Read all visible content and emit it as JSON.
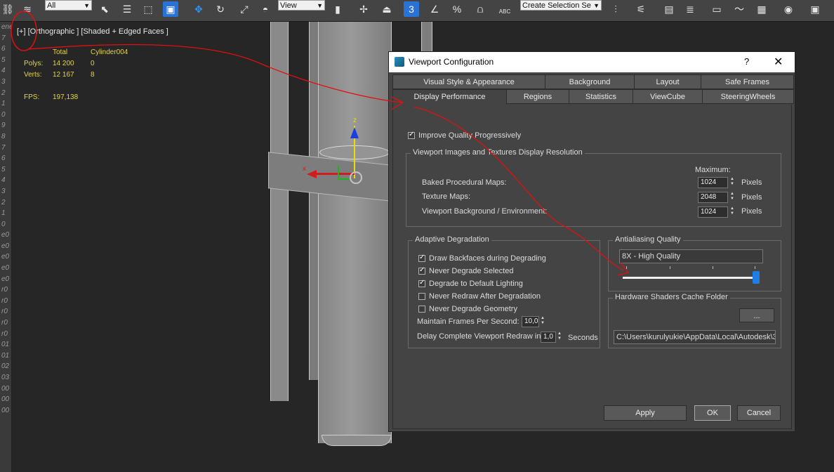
{
  "toolbar": {
    "filter_select": "All",
    "refcoord_select": "View",
    "selection_set_placeholder": "Create Selection Se",
    "snap_label": "3",
    "percent_label": "%",
    "abc_label": "ABC"
  },
  "left_strip": [
    "ene",
    "7",
    "6",
    "5",
    "4",
    "3",
    "2",
    "1",
    "0",
    "9",
    "8",
    "7",
    "6",
    "5",
    "4",
    "3",
    "2",
    "1",
    "0",
    "e0",
    "e0",
    "e0",
    "e0",
    "e0",
    "r0",
    "r0",
    "r0",
    "r0",
    "r0",
    "01",
    "01",
    "02",
    "03",
    "00",
    "00",
    "00"
  ],
  "viewport": {
    "label": "[+] [Orthographic ] [Shaded + Edged Faces ]",
    "stats": {
      "total_header": "Total",
      "object_name": "Cylinder004",
      "polys_label": "Polys:",
      "polys_total": "14 200",
      "polys_obj": "0",
      "verts_label": "Verts:",
      "verts_total": "12 167",
      "verts_obj": "8",
      "fps_label": "FPS:",
      "fps_value": "197,138"
    },
    "gizmo": {
      "z": "z",
      "x": "x"
    }
  },
  "dialog": {
    "title": "Viewport Configuration",
    "help": "?",
    "close": "✕",
    "tabs_row1": [
      "Visual Style & Appearance",
      "Background",
      "Layout",
      "Safe Frames"
    ],
    "tabs_row2": [
      "Display Performance",
      "Regions",
      "Statistics",
      "ViewCube",
      "SteeringWheels"
    ],
    "improve_quality": "Improve Quality Progressively",
    "resolution_group": {
      "title": "Viewport Images and Textures Display Resolution",
      "maximum": "Maximum:",
      "rows": [
        {
          "label": "Baked Procedural Maps:",
          "value": "1024",
          "unit": "Pixels"
        },
        {
          "label": "Texture Maps:",
          "value": "2048",
          "unit": "Pixels"
        },
        {
          "label": "Viewport Background / Environment:",
          "value": "1024",
          "unit": "Pixels"
        }
      ]
    },
    "adaptive_group": {
      "title": "Adaptive Degradation",
      "options": [
        {
          "label": "Draw Backfaces during Degrading",
          "checked": true
        },
        {
          "label": "Never Degrade Selected",
          "checked": true
        },
        {
          "label": "Degrade to Default Lighting",
          "checked": true
        },
        {
          "label": "Never Redraw After Degradation",
          "checked": false
        },
        {
          "label": "Never Degrade Geometry",
          "checked": false
        }
      ],
      "maintain_label": "Maintain Frames Per Second:",
      "maintain_value": "10,0",
      "delay_label": "Delay Complete Viewport Redraw in",
      "delay_value": "1,0",
      "delay_unit": "Seconds"
    },
    "antialiasing_group": {
      "title": "Antialiasing Quality",
      "value": "8X - High Quality",
      "slider_level": 1.0
    },
    "shader_group": {
      "title": "Hardware Shaders Cache Folder",
      "browse": "...",
      "path": "C:\\Users\\kurulyukie\\AppData\\Local\\Autodesk\\3"
    },
    "buttons": {
      "apply": "Apply",
      "ok": "OK",
      "cancel": "Cancel"
    }
  },
  "colors": {
    "accent": "#2b72d6",
    "annotation": "#e01010",
    "stats": "#e6d44a"
  }
}
